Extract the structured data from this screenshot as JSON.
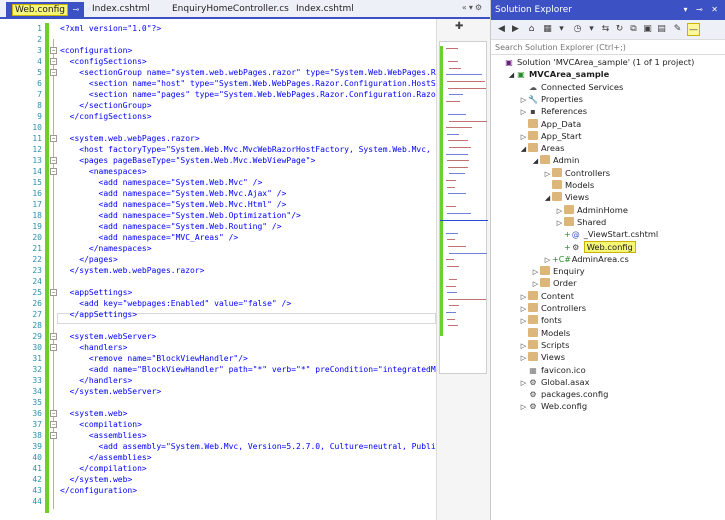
{
  "tabs": [
    {
      "label": "Web.config",
      "active": true
    },
    {
      "label": "Index.cshtml",
      "active": false
    },
    {
      "label": "EnquiryHomeController.cs",
      "active": false
    },
    {
      "label": "Index.cshtml",
      "active": false
    }
  ],
  "editor": {
    "lines": [
      {
        "n": "1",
        "text": "<?xml version=\"1.0\"?>"
      },
      {
        "n": "2",
        "text": ""
      },
      {
        "n": "3",
        "text": "<configuration>"
      },
      {
        "n": "4",
        "text": "  <configSections>"
      },
      {
        "n": "5",
        "text": "    <sectionGroup name=\"system.web.webPages.razor\" type=\"System.Web.WebPages.Ra"
      },
      {
        "n": "6",
        "text": "      <section name=\"host\" type=\"System.Web.WebPages.Razor.Configuration.HostSe"
      },
      {
        "n": "7",
        "text": "      <section name=\"pages\" type=\"System.Web.WebPages.Razor.Configuration.Razor"
      },
      {
        "n": "8",
        "text": "    </sectionGroup>"
      },
      {
        "n": "9",
        "text": "  </configSections>"
      },
      {
        "n": "10",
        "text": ""
      },
      {
        "n": "11",
        "text": "  <system.web.webPages.razor>"
      },
      {
        "n": "12",
        "text": "    <host factoryType=\"System.Web.Mvc.MvcWebRazorHostFactory, System.Web.Mvc, V"
      },
      {
        "n": "13",
        "text": "    <pages pageBaseType=\"System.Web.Mvc.WebViewPage\">"
      },
      {
        "n": "14",
        "text": "      <namespaces>"
      },
      {
        "n": "15",
        "text": "        <add namespace=\"System.Web.Mvc\" />"
      },
      {
        "n": "16",
        "text": "        <add namespace=\"System.Web.Mvc.Ajax\" />"
      },
      {
        "n": "17",
        "text": "        <add namespace=\"System.Web.Mvc.Html\" />"
      },
      {
        "n": "18",
        "text": "        <add namespace=\"System.Web.Optimization\"/>"
      },
      {
        "n": "19",
        "text": "        <add namespace=\"System.Web.Routing\" />"
      },
      {
        "n": "20",
        "text": "        <add namespace=\"MVC_Areas\" />"
      },
      {
        "n": "21",
        "text": "      </namespaces>"
      },
      {
        "n": "22",
        "text": "    </pages>"
      },
      {
        "n": "23",
        "text": "  </system.web.webPages.razor>"
      },
      {
        "n": "24",
        "text": ""
      },
      {
        "n": "25",
        "text": "  <appSettings>"
      },
      {
        "n": "26",
        "text": "    <add key=\"webpages:Enabled\" value=\"false\" />"
      },
      {
        "n": "27",
        "text": "  </appSettings>"
      },
      {
        "n": "28",
        "text": ""
      },
      {
        "n": "29",
        "text": "  <system.webServer>"
      },
      {
        "n": "30",
        "text": "    <handlers>"
      },
      {
        "n": "31",
        "text": "      <remove name=\"BlockViewHandler\"/>"
      },
      {
        "n": "32",
        "text": "      <add name=\"BlockViewHandler\" path=\"*\" verb=\"*\" preCondition=\"integratedMo"
      },
      {
        "n": "33",
        "text": "    </handlers>"
      },
      {
        "n": "34",
        "text": "  </system.webServer>"
      },
      {
        "n": "35",
        "text": ""
      },
      {
        "n": "36",
        "text": "  <system.web>"
      },
      {
        "n": "37",
        "text": "    <compilation>"
      },
      {
        "n": "38",
        "text": "      <assemblies>"
      },
      {
        "n": "39",
        "text": "        <add assembly=\"System.Web.Mvc, Version=5.2.7.0, Culture=neutral, Publi"
      },
      {
        "n": "40",
        "text": "      </assemblies>"
      },
      {
        "n": "41",
        "text": "    </compilation>"
      },
      {
        "n": "42",
        "text": "  </system.web>"
      },
      {
        "n": "43",
        "text": "</configuration>"
      },
      {
        "n": "44",
        "text": ""
      }
    ]
  },
  "solution_explorer": {
    "title": "Solution Explorer",
    "search_placeholder": "Search Solution Explorer (Ctrl+;)",
    "tree": [
      {
        "label": "Solution 'MVCArea_sample' (1 of 1 project)",
        "depth": 0,
        "exp": "",
        "icon": "solution-icon"
      },
      {
        "label": "MVCArea_sample",
        "depth": 1,
        "exp": "◢",
        "icon": "project-icon",
        "bold": true
      },
      {
        "label": "Connected Services",
        "depth": 2,
        "exp": "",
        "icon": "connected-services-icon"
      },
      {
        "label": "Properties",
        "depth": 2,
        "exp": "▷",
        "icon": "properties-icon"
      },
      {
        "label": "References",
        "depth": 2,
        "exp": "▷",
        "icon": "references-icon"
      },
      {
        "label": "App_Data",
        "depth": 2,
        "exp": "",
        "icon": "folder-icon"
      },
      {
        "label": "App_Start",
        "depth": 2,
        "exp": "▷",
        "icon": "folder-icon"
      },
      {
        "label": "Areas",
        "depth": 2,
        "exp": "◢",
        "icon": "folder-icon"
      },
      {
        "label": "Admin",
        "depth": 3,
        "exp": "◢",
        "icon": "folder-icon"
      },
      {
        "label": "Controllers",
        "depth": 4,
        "exp": "▷",
        "icon": "folder-icon"
      },
      {
        "label": "Models",
        "depth": 4,
        "exp": "",
        "icon": "folder-icon"
      },
      {
        "label": "Views",
        "depth": 4,
        "exp": "◢",
        "icon": "folder-icon"
      },
      {
        "label": "AdminHome",
        "depth": 5,
        "exp": "▷",
        "icon": "folder-icon"
      },
      {
        "label": "Shared",
        "depth": 5,
        "exp": "▷",
        "icon": "folder-icon"
      },
      {
        "label": "_ViewStart.cshtml",
        "depth": 5,
        "exp": "",
        "icon": "razor-file-icon",
        "prefix": "+[@]"
      },
      {
        "label": "Web.config",
        "depth": 5,
        "exp": "",
        "icon": "config-file-icon",
        "prefix": "+",
        "selected": true
      },
      {
        "label": "AdminArea.cs",
        "depth": 4,
        "exp": "▷",
        "icon": "csharp-file-icon",
        "prefix": "+"
      },
      {
        "label": "Enquiry",
        "depth": 3,
        "exp": "▷",
        "icon": "folder-icon"
      },
      {
        "label": "Order",
        "depth": 3,
        "exp": "▷",
        "icon": "folder-icon"
      },
      {
        "label": "Content",
        "depth": 2,
        "exp": "▷",
        "icon": "folder-icon"
      },
      {
        "label": "Controllers",
        "depth": 2,
        "exp": "▷",
        "icon": "folder-icon"
      },
      {
        "label": "fonts",
        "depth": 2,
        "exp": "▷",
        "icon": "folder-icon"
      },
      {
        "label": "Models",
        "depth": 2,
        "exp": "",
        "icon": "folder-icon"
      },
      {
        "label": "Scripts",
        "depth": 2,
        "exp": "▷",
        "icon": "folder-icon"
      },
      {
        "label": "Views",
        "depth": 2,
        "exp": "▷",
        "icon": "folder-icon"
      },
      {
        "label": "favicon.ico",
        "depth": 2,
        "exp": "",
        "icon": "image-file-icon"
      },
      {
        "label": "Global.asax",
        "depth": 2,
        "exp": "▷",
        "icon": "asax-file-icon"
      },
      {
        "label": "packages.config",
        "depth": 2,
        "exp": "",
        "icon": "config-file-icon"
      },
      {
        "label": "Web.config",
        "depth": 2,
        "exp": "▷",
        "icon": "config-file-icon"
      }
    ]
  },
  "colors": {
    "accent": "#3c52c4",
    "change_bar": "#6ccf2a",
    "highlight": "#f5f576"
  }
}
